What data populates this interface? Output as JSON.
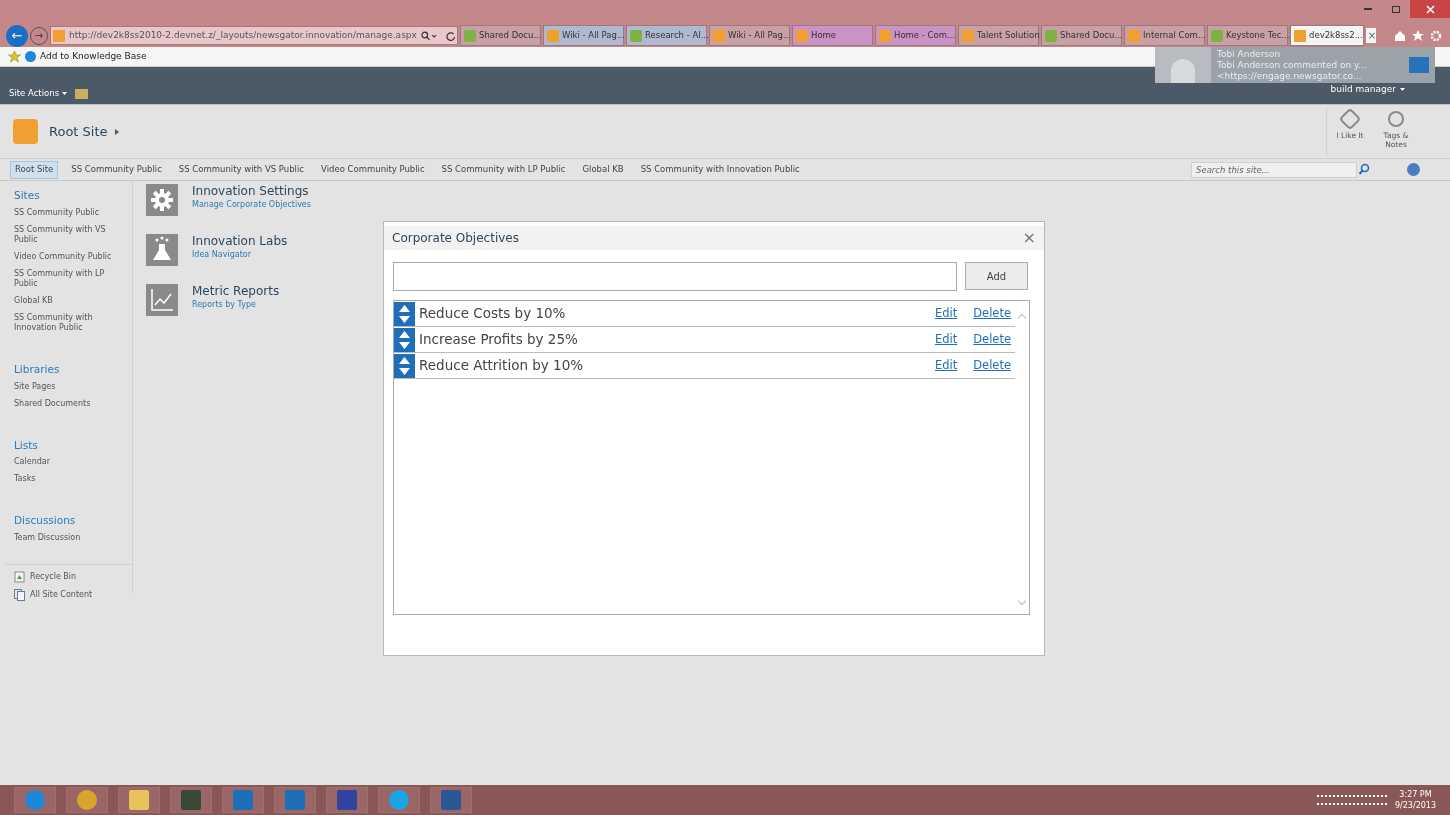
{
  "browser": {
    "back_glyph": "←",
    "forward_glyph": "→",
    "address": "http://dev2k8ss2010-2.devnet.z/_layouts/newsgator.innovation/manage.aspx",
    "tabs": [
      {
        "label": "Shared Docu...",
        "kind": "ng",
        "color": "#c9a0a3",
        "selected": false
      },
      {
        "label": "Wiki - All Pag...",
        "kind": "sp",
        "color": "#b0b9cf",
        "selected": false
      },
      {
        "label": "Research - Al...",
        "kind": "ng",
        "color": "#b0b9cf",
        "selected": false
      },
      {
        "label": "Wiki - All Pag...",
        "kind": "sp",
        "color": "#c9a0a3",
        "selected": false
      },
      {
        "label": "Home",
        "kind": "sp",
        "color": "#c993c6",
        "selected": false
      },
      {
        "label": "Home - Com...",
        "kind": "sp",
        "color": "#c993c6",
        "selected": false
      },
      {
        "label": "Talent Solution",
        "kind": "sp",
        "color": "#c9a0a3",
        "selected": false
      },
      {
        "label": "Shared Docu...",
        "kind": "ng",
        "color": "#c9a0a3",
        "selected": false
      },
      {
        "label": "Internal Com...",
        "kind": "sp",
        "color": "#c9a0a3",
        "selected": false
      },
      {
        "label": "Keystone Tec...",
        "kind": "ng",
        "color": "#c9a0a3",
        "selected": false
      },
      {
        "label": "dev2k8ss2...",
        "kind": "sp",
        "color": "#f4f4f4",
        "selected": true
      }
    ],
    "close_tab": "×",
    "favorites": [
      {
        "label": "Add to Knowledge Base"
      }
    ]
  },
  "notification": {
    "title": "Tobi Anderson",
    "lines": [
      "Tobi Anderson commented on y...",
      "<https://engage.newsgator.co..."
    ]
  },
  "ribbon": {
    "site_actions": "Site Actions",
    "user": "build manager"
  },
  "title_area": {
    "site": "Root Site",
    "actions": [
      {
        "label": "I Like It",
        "kind": "like"
      },
      {
        "label": "Tags & Notes",
        "kind": "tags"
      }
    ]
  },
  "top_nav": {
    "items": [
      {
        "label": "Root Site",
        "selected": true
      },
      {
        "label": "SS Community Public",
        "selected": false
      },
      {
        "label": "SS Community with VS Public",
        "selected": false
      },
      {
        "label": "Video Community Public",
        "selected": false
      },
      {
        "label": "SS Community with LP Public",
        "selected": false
      },
      {
        "label": "Global KB",
        "selected": false
      },
      {
        "label": "SS Community with Innovation Public",
        "selected": false
      }
    ],
    "search_placeholder": "Search this site..."
  },
  "sidebar": {
    "sections": [
      {
        "heading": "Sites",
        "items": [
          "SS Community Public",
          "SS Community with VS Public",
          "Video Community Public",
          "SS Community with LP Public",
          "Global KB",
          "SS Community with Innovation Public"
        ]
      },
      {
        "heading": "Libraries",
        "items": [
          "Site Pages",
          "Shared Documents"
        ]
      },
      {
        "heading": "Lists",
        "items": [
          "Calendar",
          "Tasks"
        ]
      },
      {
        "heading": "Discussions",
        "items": [
          "Team Discussion"
        ]
      }
    ],
    "footer": [
      {
        "label": "Recycle Bin",
        "kind": "bin"
      },
      {
        "label": "All Site Content",
        "kind": "content"
      }
    ]
  },
  "features": [
    {
      "title": "Innovation Settings",
      "link": "Manage Corporate Objectives",
      "kind": "gear"
    },
    {
      "title": "Innovation Labs",
      "link": "Idea Navigator",
      "kind": "flask"
    },
    {
      "title": "Metric Reports",
      "link": "Reports by Type",
      "kind": "chart"
    }
  ],
  "dialog": {
    "title": "Corporate Objectives",
    "close": "×",
    "add": "Add",
    "objectives": [
      {
        "text": "Reduce Costs by 10%",
        "edit": "Edit",
        "delete": "Delete"
      },
      {
        "text": "Increase Profits by 25%",
        "edit": "Edit",
        "delete": "Delete"
      },
      {
        "text": "Reduce Attrition by 10%",
        "edit": "Edit",
        "delete": "Delete"
      }
    ]
  },
  "taskbar": {
    "apps": [
      {
        "kind": "ie"
      },
      {
        "kind": "chrome"
      },
      {
        "kind": "folder"
      },
      {
        "kind": "tool"
      },
      {
        "kind": "outlook"
      },
      {
        "kind": "lync"
      },
      {
        "kind": "infinity"
      },
      {
        "kind": "skype"
      },
      {
        "kind": "word"
      }
    ],
    "time": "3:27 PM",
    "date": "9/23/2013"
  }
}
